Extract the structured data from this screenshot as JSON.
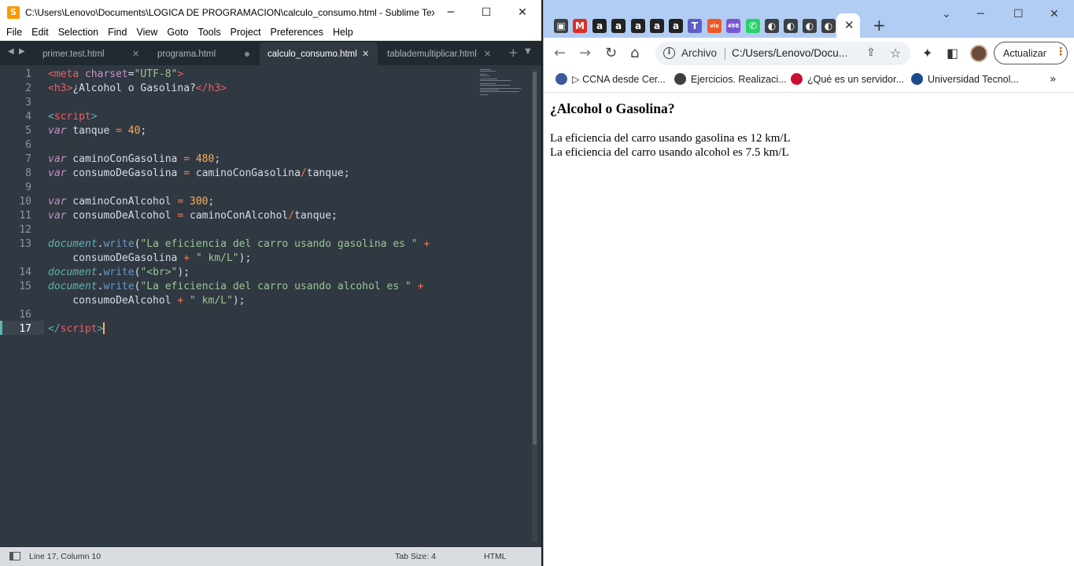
{
  "sublime": {
    "title": "C:\\Users\\Lenovo\\Documents\\LOGICA DE PROGRAMACION\\calculo_consumo.html - Sublime Tex...",
    "app_icon_letter": "S",
    "window_controls": [
      "─",
      "☐",
      "✕"
    ],
    "menu": [
      "File",
      "Edit",
      "Selection",
      "Find",
      "View",
      "Goto",
      "Tools",
      "Project",
      "Preferences",
      "Help"
    ],
    "tabs": [
      {
        "label": "primer.test.html",
        "state": "close"
      },
      {
        "label": "programa.html",
        "state": "modified"
      },
      {
        "label": "calculo_consumo.html",
        "state": "active"
      },
      {
        "label": "tablademultiplicar.html",
        "state": "close"
      }
    ],
    "tab_close_glyph": "✕",
    "tab_nav": [
      "◀",
      "▶"
    ],
    "tab_new": "+",
    "tab_menu": "▼",
    "line_numbers": [
      "1",
      "2",
      "3",
      "4",
      "5",
      "6",
      "7",
      "8",
      "9",
      "10",
      "11",
      "12",
      "13",
      "",
      "14",
      "15",
      "",
      "16",
      "17"
    ],
    "current_line": "17",
    "code": [
      [
        [
          "t-tag",
          "<"
        ],
        [
          "t-tag",
          "meta"
        ],
        [
          "t-plain",
          " "
        ],
        [
          "t-attr",
          "charset"
        ],
        [
          "t-plain",
          "="
        ],
        [
          "t-str",
          "\"UTF-8\""
        ],
        [
          "t-tag",
          ">"
        ]
      ],
      [
        [
          "t-tag",
          "<"
        ],
        [
          "t-tag",
          "h3"
        ],
        [
          "t-tag",
          ">"
        ],
        [
          "t-plain",
          "¿Alcohol o Gasolina?"
        ],
        [
          "t-tag",
          "</"
        ],
        [
          "t-tag",
          "h3"
        ],
        [
          "t-tag",
          ">"
        ]
      ],
      [],
      [
        [
          "t-punct",
          "<"
        ],
        [
          "t-tag",
          "script"
        ],
        [
          "t-punct",
          ">"
        ]
      ],
      [
        [
          "t-kw",
          "var"
        ],
        [
          "t-plain",
          " tanque "
        ],
        [
          "t-op",
          "="
        ],
        [
          "t-plain",
          " "
        ],
        [
          "t-num",
          "40"
        ],
        [
          "t-plain",
          ";"
        ]
      ],
      [],
      [
        [
          "t-kw",
          "var"
        ],
        [
          "t-plain",
          " caminoConGasolina "
        ],
        [
          "t-op",
          "="
        ],
        [
          "t-plain",
          " "
        ],
        [
          "t-num",
          "480"
        ],
        [
          "t-plain",
          ";"
        ]
      ],
      [
        [
          "t-kw",
          "var"
        ],
        [
          "t-plain",
          " consumoDeGasolina "
        ],
        [
          "t-op",
          "="
        ],
        [
          "t-plain",
          " caminoConGasolina"
        ],
        [
          "t-op",
          "/"
        ],
        [
          "t-plain",
          "tanque;"
        ]
      ],
      [],
      [
        [
          "t-kw",
          "var"
        ],
        [
          "t-plain",
          " caminoConAlcohol "
        ],
        [
          "t-op",
          "="
        ],
        [
          "t-plain",
          " "
        ],
        [
          "t-num",
          "300"
        ],
        [
          "t-plain",
          ";"
        ]
      ],
      [
        [
          "t-kw",
          "var"
        ],
        [
          "t-plain",
          " consumoDeAlcohol "
        ],
        [
          "t-op",
          "="
        ],
        [
          "t-plain",
          " caminoConAlcohol"
        ],
        [
          "t-op",
          "/"
        ],
        [
          "t-plain",
          "tanque;"
        ]
      ],
      [],
      [
        [
          "t-obj",
          "document"
        ],
        [
          "t-plain",
          "."
        ],
        [
          "t-fn",
          "write"
        ],
        [
          "t-plain",
          "("
        ],
        [
          "t-str",
          "\"La eficiencia del carro usando gasolina es \""
        ],
        [
          "t-plain",
          " "
        ],
        [
          "t-op",
          "+"
        ]
      ],
      [
        [
          "t-plain",
          "    consumoDeGasolina "
        ],
        [
          "t-op",
          "+"
        ],
        [
          "t-plain",
          " "
        ],
        [
          "t-str",
          "\" km/L\""
        ],
        [
          "t-plain",
          ");"
        ]
      ],
      [
        [
          "t-obj",
          "document"
        ],
        [
          "t-plain",
          "."
        ],
        [
          "t-fn",
          "write"
        ],
        [
          "t-plain",
          "("
        ],
        [
          "t-str",
          "\"<br>\""
        ],
        [
          "t-plain",
          ");"
        ]
      ],
      [
        [
          "t-obj",
          "document"
        ],
        [
          "t-plain",
          "."
        ],
        [
          "t-fn",
          "write"
        ],
        [
          "t-plain",
          "("
        ],
        [
          "t-str",
          "\"La eficiencia del carro usando alcohol es \""
        ],
        [
          "t-plain",
          " "
        ],
        [
          "t-op",
          "+"
        ]
      ],
      [
        [
          "t-plain",
          "    consumoDeAlcohol "
        ],
        [
          "t-op",
          "+"
        ],
        [
          "t-plain",
          " "
        ],
        [
          "t-str",
          "\" km/L\""
        ],
        [
          "t-plain",
          ");"
        ]
      ],
      [],
      [
        [
          "t-punct",
          "</"
        ],
        [
          "t-tag",
          "script"
        ],
        [
          "t-punct",
          ">"
        ]
      ]
    ],
    "status": {
      "position": "Line 17, Column 10",
      "tab_size": "Tab Size: 4",
      "syntax": "HTML"
    }
  },
  "chrome": {
    "favicons": [
      {
        "icon": "nav-cloud-icon",
        "glyph": "▣",
        "color": "#3c4043"
      },
      {
        "icon": "gmail-icon",
        "glyph": "M",
        "color": "#d93025"
      },
      {
        "icon": "amazon-icon",
        "glyph": "a",
        "color": "#222222"
      },
      {
        "icon": "amazon-icon",
        "glyph": "a",
        "color": "#222222"
      },
      {
        "icon": "amazon-icon",
        "glyph": "a",
        "color": "#222222"
      },
      {
        "icon": "amazon-icon",
        "glyph": "a",
        "color": "#222222"
      },
      {
        "icon": "amazon-icon",
        "glyph": "a",
        "color": "#222222"
      },
      {
        "icon": "teams-icon",
        "glyph": "T",
        "color": "#5b5fc7"
      },
      {
        "icon": "vix-icon",
        "glyph": "vix",
        "color": "#f05a28"
      },
      {
        "icon": "badge-498-icon",
        "glyph": "498",
        "color": "#7a57d1"
      },
      {
        "icon": "whatsapp-icon",
        "glyph": "✆",
        "color": "#25d366"
      },
      {
        "icon": "globe-icon",
        "glyph": "◐",
        "color": "#3c4043"
      },
      {
        "icon": "globe-icon",
        "glyph": "◐",
        "color": "#3c4043"
      },
      {
        "icon": "globe-icon",
        "glyph": "◐",
        "color": "#3c4043"
      },
      {
        "icon": "globe-icon",
        "glyph": "◐",
        "color": "#3c4043"
      }
    ],
    "active_tab_close": "✕",
    "new_tab": "+",
    "window_controls": [
      "⌄",
      "─",
      "☐",
      "✕"
    ],
    "nav": {
      "back": "←",
      "forward": "→",
      "reload": "↻",
      "home": "⌂"
    },
    "omnibox": {
      "info": "i",
      "scheme_label": "Archivo",
      "url": "C:/Users/Lenovo/Docu...",
      "share": "⇪",
      "star": "☆"
    },
    "toolbar_icons": {
      "extensions": "✦",
      "sidepanel": "◧"
    },
    "update_button": {
      "label": "Actualizar",
      "dots": "⋮"
    },
    "bookmarks": [
      {
        "label": "▷ CCNA desde Cer...",
        "color": "#3c5a99"
      },
      {
        "label": "Ejercicios. Realizaci...",
        "color": "#3c4043"
      },
      {
        "label": "¿Qué es un servidor...",
        "color": "#c8102e"
      },
      {
        "label": "Universidad Tecnol...",
        "color": "#1a4b8c"
      }
    ],
    "bookmarks_more": "»",
    "page": {
      "heading": "¿Alcohol o Gasolina?",
      "line1": "La eficiencia del carro usando gasolina es 12 km/L",
      "line2": "La eficiencia del carro usando alcohol es 7.5 km/L"
    }
  }
}
